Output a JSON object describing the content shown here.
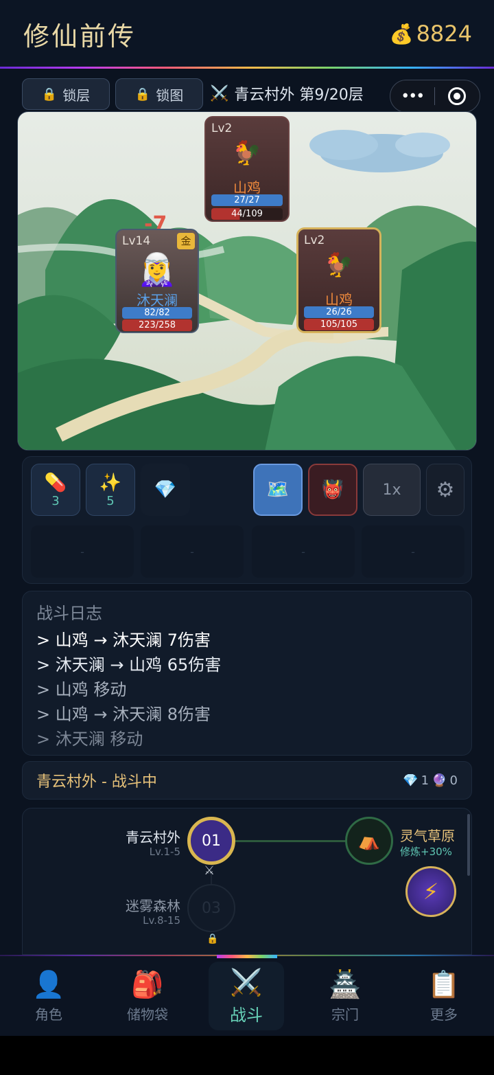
{
  "app": {
    "title": "修仙前传",
    "gold_icon": "money-bag-icon",
    "gold": "8824"
  },
  "toolbar": {
    "lock_floor": "锁层",
    "lock_map": "锁图",
    "stage": "青云村外 第9/20层",
    "capsule_more": "•••"
  },
  "battle": {
    "damage_popup": "-7",
    "hero": {
      "level": "Lv14",
      "name": "沐天澜",
      "badge": "金",
      "mp": "82/82",
      "hp": "223/258"
    },
    "enemy_top": {
      "level": "Lv2",
      "name": "山鸡",
      "mp": "27/27",
      "hp": "44/109"
    },
    "enemy_right": {
      "level": "Lv2",
      "name": "山鸡",
      "mp": "26/26",
      "hp": "105/105"
    }
  },
  "actions": {
    "pill_count": "3",
    "spark_count": "5",
    "speed": "1x",
    "slots": [
      "-",
      "-",
      "-",
      "-"
    ]
  },
  "log": {
    "title": "战斗日志",
    "lines": [
      "> 山鸡 → 沐天澜 7伤害",
      "> 沐天澜 → 山鸡 65伤害",
      "> 山鸡 移动",
      "> 山鸡 → 沐天澜 8伤害",
      "> 沐天澜 移动"
    ]
  },
  "status": {
    "text": "青云村外 - 战斗中",
    "gems": "1",
    "orbs": "0"
  },
  "map": {
    "node1": {
      "name": "青云村外",
      "range": "Lv.1-5",
      "num": "01"
    },
    "node2": {
      "name": "迷雾森林",
      "range": "Lv.8-15",
      "num": "03"
    },
    "branch": {
      "name": "灵气草原",
      "bonus": "修炼+30%"
    }
  },
  "nav": [
    {
      "label": "角色",
      "icon": "person-icon"
    },
    {
      "label": "储物袋",
      "icon": "backpack-icon"
    },
    {
      "label": "战斗",
      "icon": "crossed-swords-icon"
    },
    {
      "label": "宗门",
      "icon": "temple-icon"
    },
    {
      "label": "更多",
      "icon": "clipboard-icon"
    }
  ],
  "colors": {
    "accent": "#67d2b8",
    "gold": "#e9c46a",
    "hp": "#b2332f",
    "mp": "#3e7cc9"
  }
}
